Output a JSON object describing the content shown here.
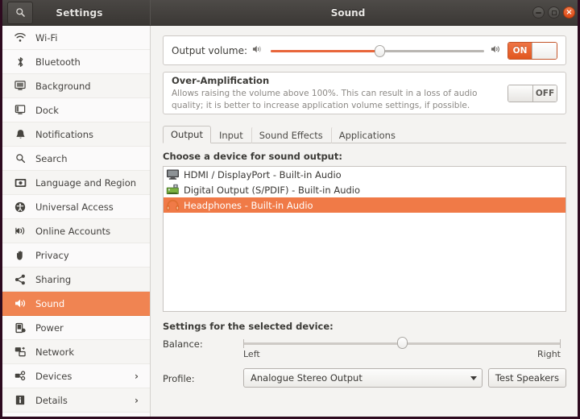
{
  "window": {
    "sidebar_title": "Settings",
    "main_title": "Sound",
    "search_icon": "search-icon",
    "buttons": {
      "minimize": "minimize",
      "maximize": "maximize",
      "close": "×"
    }
  },
  "sidebar": {
    "items": [
      {
        "label": "Wi-Fi",
        "icon": "wifi-icon",
        "selected": false,
        "submenu": false
      },
      {
        "label": "Bluetooth",
        "icon": "bluetooth-icon",
        "selected": false,
        "submenu": false
      },
      {
        "label": "Background",
        "icon": "background-icon",
        "selected": false,
        "submenu": false
      },
      {
        "label": "Dock",
        "icon": "dock-icon",
        "selected": false,
        "submenu": false
      },
      {
        "label": "Notifications",
        "icon": "bell-icon",
        "selected": false,
        "submenu": false
      },
      {
        "label": "Search",
        "icon": "search-icon",
        "selected": false,
        "submenu": false
      },
      {
        "label": "Language and Region",
        "icon": "language-icon",
        "selected": false,
        "submenu": false
      },
      {
        "label": "Universal Access",
        "icon": "universal-access-icon",
        "selected": false,
        "submenu": false
      },
      {
        "label": "Online Accounts",
        "icon": "online-accounts-icon",
        "selected": false,
        "submenu": false
      },
      {
        "label": "Privacy",
        "icon": "privacy-hand-icon",
        "selected": false,
        "submenu": false
      },
      {
        "label": "Sharing",
        "icon": "sharing-icon",
        "selected": false,
        "submenu": false
      },
      {
        "label": "Sound",
        "icon": "sound-icon",
        "selected": true,
        "submenu": false
      },
      {
        "label": "Power",
        "icon": "power-battery-icon",
        "selected": false,
        "submenu": false
      },
      {
        "label": "Network",
        "icon": "network-icon",
        "selected": false,
        "submenu": false
      },
      {
        "label": "Devices",
        "icon": "devices-icon",
        "selected": false,
        "submenu": true
      },
      {
        "label": "Details",
        "icon": "details-info-icon",
        "selected": false,
        "submenu": true
      }
    ],
    "chevron": "›"
  },
  "volume": {
    "label": "Output volume:",
    "low_icon": "speaker-low-icon",
    "high_icon": "speaker-high-icon",
    "value_percent": 51,
    "toggle_state": "ON"
  },
  "over_amplification": {
    "title": "Over-Amplification",
    "description": "Allows raising the volume above 100%. This can result in a loss of audio quality; it is better to increase application volume settings, if possible.",
    "toggle_state": "OFF"
  },
  "tabs": [
    {
      "label": "Output",
      "active": true
    },
    {
      "label": "Input",
      "active": false
    },
    {
      "label": "Sound Effects",
      "active": false
    },
    {
      "label": "Applications",
      "active": false
    }
  ],
  "device_list": {
    "heading": "Choose a device for sound output:",
    "devices": [
      {
        "label": "HDMI / DisplayPort - Built-in Audio",
        "icon": "monitor-icon",
        "selected": false
      },
      {
        "label": "Digital Output (S/PDIF) - Built-in Audio",
        "icon": "soundcard-icon",
        "selected": false
      },
      {
        "label": "Headphones - Built-in Audio",
        "icon": "headphones-icon",
        "selected": true
      }
    ]
  },
  "selected_device_settings": {
    "heading": "Settings for the selected device:",
    "balance_label": "Balance:",
    "balance_left": "Left",
    "balance_right": "Right",
    "balance_value_percent": 50,
    "profile_label": "Profile:",
    "profile_value": "Analogue Stereo Output",
    "test_speakers_label": "Test Speakers"
  },
  "colors": {
    "accent_orange": "#e8663b",
    "selection_orange": "#f07a47",
    "titlebar_dark": "#3b3835",
    "window_border": "#2d0a1f"
  }
}
